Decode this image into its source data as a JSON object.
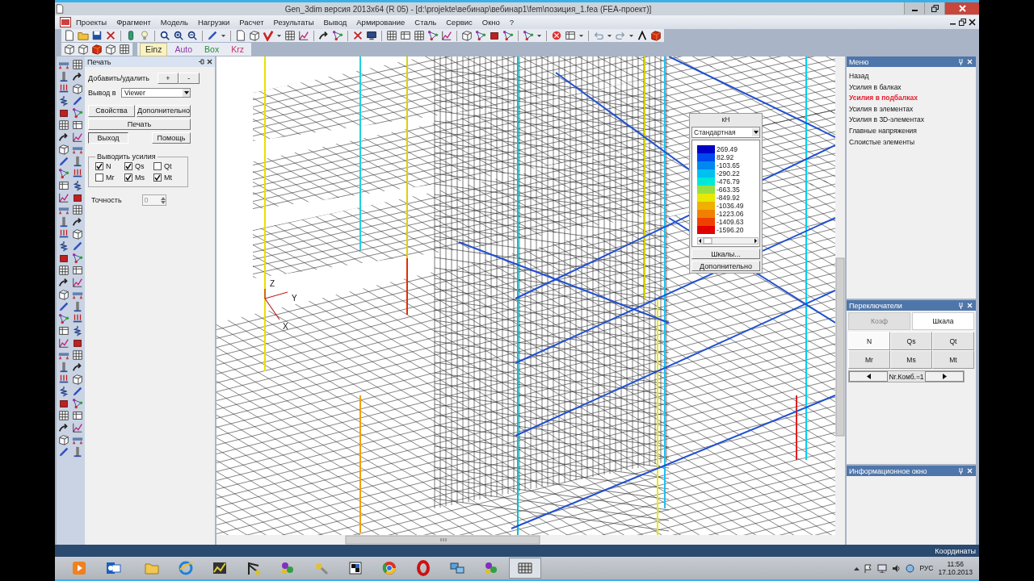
{
  "window": {
    "title": "Gen_3dim версия 2013x64 (R 05) - [d:\\projekte\\вебинар\\вебинар1\\fem\\позиция_1.fea  (FEA-проект)]"
  },
  "menu": [
    "Проекты",
    "Фрагмент",
    "Модель",
    "Нагрузки",
    "Расчет",
    "Результаты",
    "Вывод",
    "Армирование",
    "Сталь",
    "Сервис",
    "Окно",
    "?"
  ],
  "view_modes": [
    {
      "label": "Einz",
      "selected": true,
      "color": "#303030"
    },
    {
      "label": "Auto",
      "selected": false,
      "color": "#8a3aa8"
    },
    {
      "label": "Box",
      "selected": false,
      "color": "#2a8a3a"
    },
    {
      "label": "Krz",
      "selected": false,
      "color": "#c8306a"
    }
  ],
  "print_panel": {
    "title": "Печать",
    "add_remove_label": "Добавить/удалить",
    "add_button": "+",
    "remove_button": "-",
    "output_label": "Вывод в",
    "output_value": "Viewer",
    "properties_button": "Свойства",
    "more_button": "Дополнительно",
    "print_button": "Печать",
    "exit_button": "Выход",
    "help_button": "Помощь",
    "forces_group": {
      "title": "Выводить усилия",
      "options": [
        {
          "label": "N",
          "checked": true
        },
        {
          "label": "Qs",
          "checked": true
        },
        {
          "label": "Qt",
          "checked": false
        },
        {
          "label": "Mr",
          "checked": false
        },
        {
          "label": "Ms",
          "checked": true
        },
        {
          "label": "Mt",
          "checked": true
        }
      ]
    },
    "precision_label": "Точность",
    "precision_value": "0"
  },
  "viewport": {
    "axis_labels": [
      "Z",
      "Y",
      "X"
    ]
  },
  "legend": {
    "unit": "кН",
    "scale": "Стандартная",
    "entries": [
      {
        "value": "269.49",
        "color": "#0000c8"
      },
      {
        "value": "82.92",
        "color": "#0048f0"
      },
      {
        "value": "-103.65",
        "color": "#0088f0"
      },
      {
        "value": "-290.22",
        "color": "#00c0f0"
      },
      {
        "value": "-476.79",
        "color": "#00e8d8"
      },
      {
        "value": "-663.35",
        "color": "#98e040"
      },
      {
        "value": "-849.92",
        "color": "#e8e800"
      },
      {
        "value": "-1036.49",
        "color": "#f0b000"
      },
      {
        "value": "-1223.06",
        "color": "#f08000"
      },
      {
        "value": "-1409.63",
        "color": "#f04000"
      },
      {
        "value": "-1596.20",
        "color": "#e00000"
      }
    ],
    "scales_button": "Шкалы...",
    "more_button": "Дополнительно"
  },
  "menu_panel": {
    "title": "Меню",
    "items": [
      {
        "label": "Назад",
        "selected": false
      },
      {
        "label": "Усилия в балках",
        "selected": false
      },
      {
        "label": "Усилия в подбалках",
        "selected": true
      },
      {
        "label": "Усилия в элементах",
        "selected": false
      },
      {
        "label": "Усилия в 3D-элементах",
        "selected": false
      },
      {
        "label": "Главные напряжения",
        "selected": false
      },
      {
        "label": "Слоистые элементы",
        "selected": false
      }
    ]
  },
  "switches_panel": {
    "title": "Переключатели",
    "tabs": [
      {
        "label": "Коэф",
        "selected": false
      },
      {
        "label": "Шкала",
        "selected": true
      }
    ],
    "forces": [
      {
        "label": "N",
        "selected": true
      },
      {
        "label": "Qs",
        "selected": false
      },
      {
        "label": "Qt",
        "selected": false
      },
      {
        "label": "Mr",
        "selected": false
      },
      {
        "label": "Ms",
        "selected": false
      },
      {
        "label": "Mt",
        "selected": false
      }
    ],
    "combination": "Nr.Комб.=1"
  },
  "info_panel": {
    "title": "Информационное окно"
  },
  "status_bar": {
    "text": "Координаты"
  },
  "taskbar": {
    "language": "РУС",
    "time": "11:56",
    "date": "17.10.2013"
  }
}
